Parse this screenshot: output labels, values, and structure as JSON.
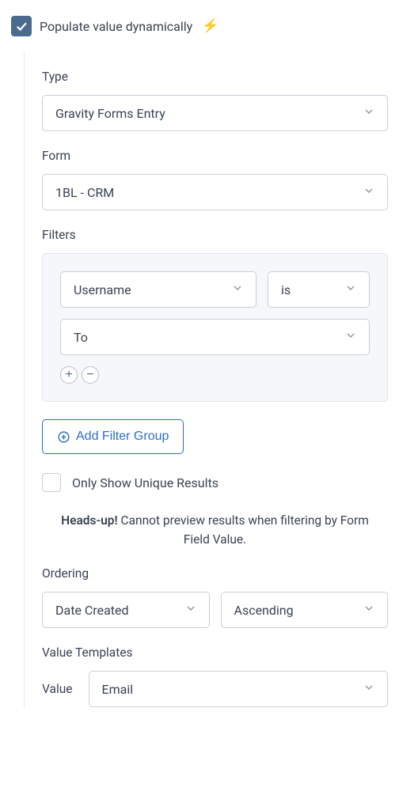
{
  "populate": {
    "label": "Populate value dynamically"
  },
  "type": {
    "label": "Type",
    "value": "Gravity Forms Entry"
  },
  "form": {
    "label": "Form",
    "value": "1BL - CRM"
  },
  "filters": {
    "label": "Filters",
    "field": "Username",
    "operator": "is",
    "value": "To",
    "addGroupLabel": "Add Filter Group"
  },
  "unique": {
    "label": "Only Show Unique Results"
  },
  "headsUp": {
    "bold": "Heads-up!",
    "text": " Cannot preview results when filtering by Form Field Value."
  },
  "ordering": {
    "label": "Ordering",
    "field": "Date Created",
    "direction": "Ascending"
  },
  "valueTemplates": {
    "label": "Value Templates",
    "fieldLabel": "Value",
    "value": "Email"
  }
}
